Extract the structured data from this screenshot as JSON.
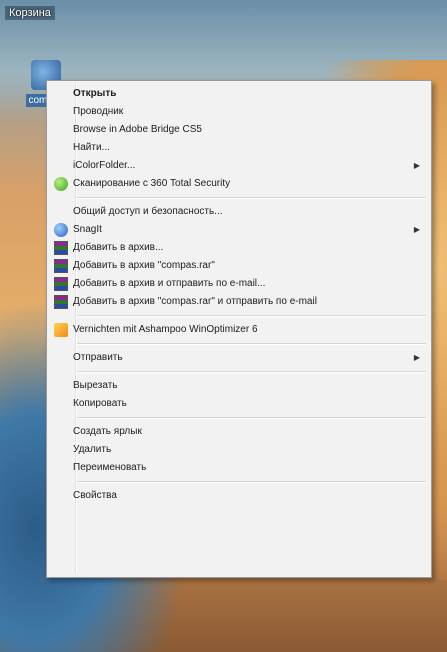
{
  "desktop": {
    "top_label": "Корзина",
    "icon_label": "compas"
  },
  "menu": {
    "group1": [
      {
        "label": "Открыть",
        "bold": true
      },
      {
        "label": "Проводник"
      },
      {
        "label": "Browse in Adobe Bridge CS5"
      },
      {
        "label": "Найти..."
      },
      {
        "label": "iColorFolder...",
        "submenu": true
      },
      {
        "label": "Сканирование с 360 Total Security",
        "icon": "360-security-icon"
      }
    ],
    "group2": [
      {
        "label": "Общий доступ и безопасность..."
      },
      {
        "label": "SnagIt",
        "icon": "snagit-icon",
        "submenu": true
      },
      {
        "label": "Добавить в архив...",
        "icon": "winrar-icon"
      },
      {
        "label": "Добавить в архив \"compas.rar\"",
        "icon": "winrar-icon"
      },
      {
        "label": "Добавить в архив и отправить по e-mail...",
        "icon": "winrar-icon"
      },
      {
        "label": "Добавить в архив \"compas.rar\" и отправить по e-mail",
        "icon": "winrar-icon"
      }
    ],
    "group3": [
      {
        "label": "Vernichten mit Ashampoo WinOptimizer 6",
        "icon": "ashampoo-icon"
      }
    ],
    "group4": [
      {
        "label": "Отправить",
        "submenu": true
      }
    ],
    "group5": [
      {
        "label": "Вырезать"
      },
      {
        "label": "Копировать"
      }
    ],
    "group6": [
      {
        "label": "Создать ярлык"
      },
      {
        "label": "Удалить"
      },
      {
        "label": "Переименовать"
      }
    ],
    "group7": [
      {
        "label": "Свойства"
      }
    ],
    "submenu_arrow": "▶"
  }
}
